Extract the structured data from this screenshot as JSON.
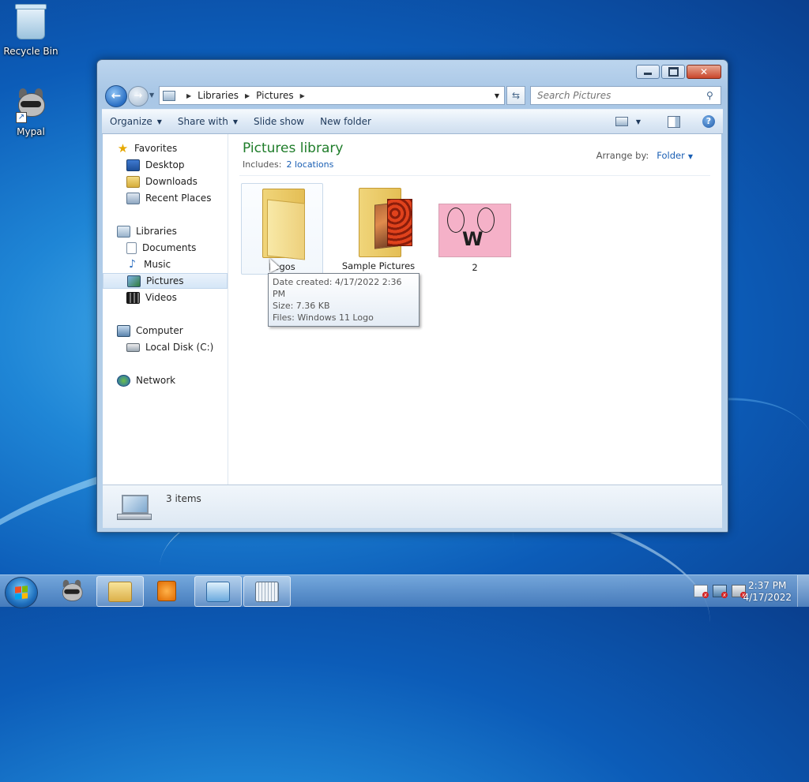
{
  "desktop": {
    "icons": [
      {
        "label": "Recycle Bin",
        "icon": "recycle-bin-icon"
      },
      {
        "label": "Mypal",
        "icon": "raccoon-icon"
      }
    ]
  },
  "window": {
    "address": {
      "crumbs": [
        "Libraries",
        "Pictures"
      ]
    },
    "search": {
      "placeholder": "Search Pictures"
    },
    "toolbar": {
      "organize": "Organize",
      "share_with": "Share with",
      "slide_show": "Slide show",
      "new_folder": "New folder"
    },
    "nav": {
      "favorites": "Favorites",
      "desktop": "Desktop",
      "downloads": "Downloads",
      "recent_places": "Recent Places",
      "libraries": "Libraries",
      "documents": "Documents",
      "music": "Music",
      "pictures": "Pictures",
      "videos": "Videos",
      "computer": "Computer",
      "local_disk": "Local Disk (C:)",
      "network": "Network"
    },
    "content": {
      "title": "Pictures library",
      "includes_label": "Includes:",
      "includes_link": "2 locations",
      "arrange_label": "Arrange by:",
      "arrange_value": "Folder",
      "items": [
        {
          "name": "Logos",
          "type": "folder"
        },
        {
          "name": "Sample Pictures",
          "type": "folder-photos"
        },
        {
          "name": "2",
          "type": "image"
        }
      ],
      "tooltip": {
        "line1": "Date created: 4/17/2022 2:36 PM",
        "line2": "Size: 7.36 KB",
        "line3": "Files: Windows 11 Logo"
      }
    },
    "details": {
      "count": "3 items"
    }
  },
  "taskbar": {
    "clock_time": "2:37 PM",
    "clock_date": "4/17/2022"
  },
  "colors": {
    "library_title": "#1f7d2a",
    "link": "#1a5fb4"
  }
}
